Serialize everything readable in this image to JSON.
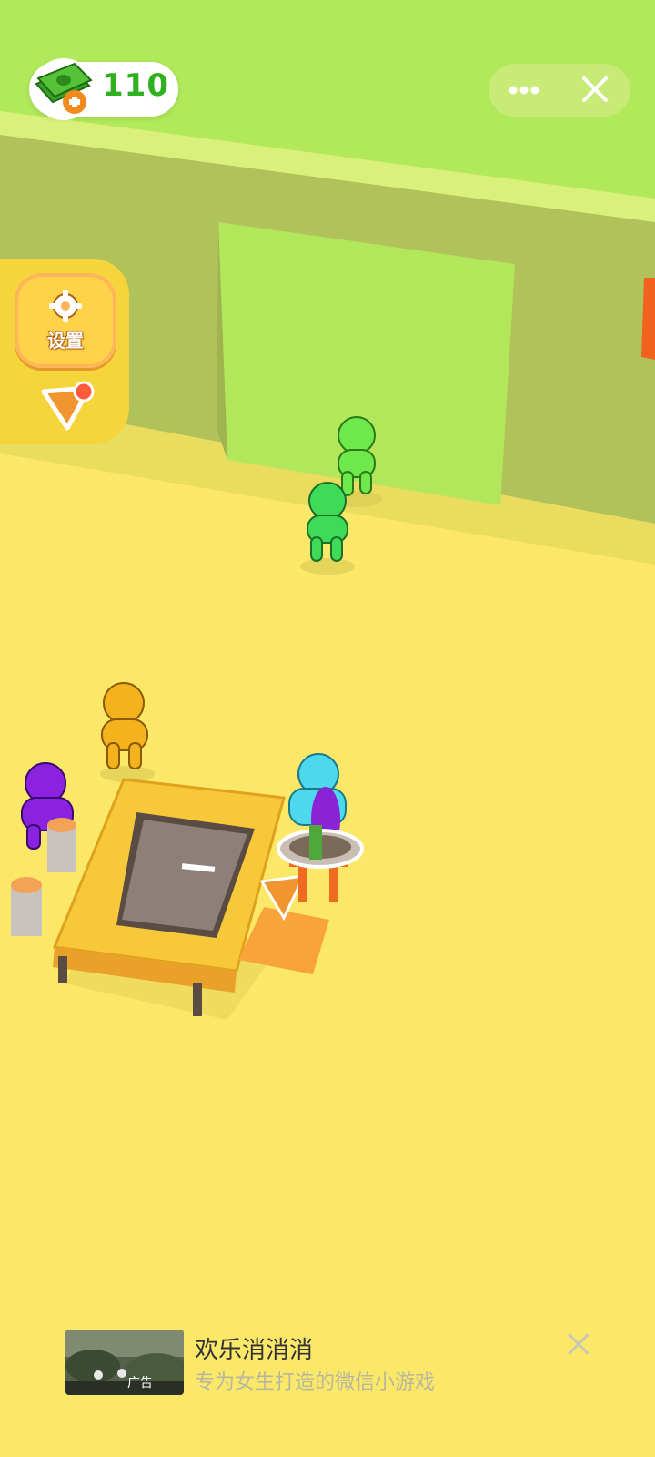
{
  "hud": {
    "money_icon": "cash-plus-icon",
    "money_value": "110",
    "capsule": {
      "more_icon": "more-dots-icon",
      "close_icon": "close-icon"
    }
  },
  "sidebar": {
    "settings_label": "设置",
    "settings_icon": "gear-icon",
    "nav_icon": "navigation-arrow-icon",
    "nav_badge_color": "#ff5a3a"
  },
  "scene": {
    "characters": [
      {
        "color": "#6ee84a",
        "role": "customer"
      },
      {
        "color": "#3fdb57",
        "role": "customer"
      },
      {
        "color": "#f4b21c",
        "role": "customer"
      },
      {
        "color": "#8a22e0",
        "role": "customer"
      },
      {
        "color": "#4ed8ee",
        "role": "player"
      }
    ],
    "colors": {
      "floor": "#fbe869",
      "wall": "#b1c25a",
      "grass": "#b0e95a",
      "counter": "#f7c93a"
    }
  },
  "ad": {
    "title": "欢乐消消消",
    "subtitle": "专为女生打造的微信小游戏",
    "tag": "广告",
    "close_icon": "close-icon"
  }
}
